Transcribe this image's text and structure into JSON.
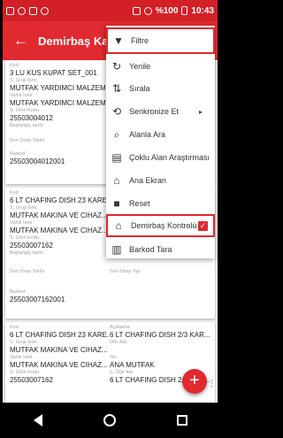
{
  "status_bar": {
    "battery": "%100",
    "time": "10:43",
    "top_right_icons": [
      "nfc-icon",
      "external-link-icon"
    ]
  },
  "app_bar": {
    "title": "Demirbaş Kay"
  },
  "cards": [
    {
      "kod_label": "Kod",
      "kod": "3 LU KUS KUPAT SET_001",
      "grup_label": "S. Grup İsmi",
      "grup": "MUTFAK YARDIMCI MALZEM...",
      "varlik_label": "Varlık İsmi",
      "varlik": "MUTFAK YARDIMCI MALZEM...",
      "urun_label": "S. Ürün Kodu",
      "urun_kodu": "25503004012",
      "baslangic_label": "Başlangıç tarihi",
      "son_onay_label": "Son Onay Tarihi",
      "barkod_label": "Barkod",
      "barkod": "25503004012001"
    },
    {
      "kod_label": "Kod",
      "kod": "6 LT CHAFING DISH 23 KARE...",
      "grup_label": "S. Grup İsmi",
      "grup": "MUTFAK MAKINA VE CIHAZ...",
      "varlik_label": "Varlık İsmi",
      "varlik": "MUTFAK MAKINA VE CIHAZ...",
      "urun_label": "S. Ürün Kodu",
      "urun_kodu": "25503007162",
      "baslangic_label": "Başlangıç tarihi",
      "son_onay_label": "Son Onay Tarihi",
      "son_onay_tipi_label": "Son Onay Tipi",
      "barkod_label": "Barkod",
      "barkod": "25503007162001"
    },
    {
      "kod_label": "Kod",
      "kod": "6 LT CHAFING DISH 23 KARE...",
      "aciklama_label": "Açıklama",
      "aciklama": "6 LT CHAFING DISH 2/3 KAR...",
      "grup_label": "S. Grup İsmi",
      "grup": "MUTFAK MAKINA VE CIHAZ...",
      "ofis_label": "Ofis Adı",
      "varlik_label": "Varlık İsmi",
      "varlik": "MUTFAK MAKINA VE CIHAZ...",
      "yer_label": "Yer",
      "yer": "ANA MUTFAK",
      "urun_label": "S. Ürün Kodu",
      "urun_kodu": "25503007162",
      "oge_label": "S. Öğe Adı",
      "oge": "6 LT CHAFING DISH 2/3 KAR..."
    }
  ],
  "menu": {
    "items": [
      {
        "icon": "filter-icon",
        "glyph": "▼",
        "label": "Filtre"
      },
      {
        "icon": "refresh-icon",
        "glyph": "↻",
        "label": "Yenile"
      },
      {
        "icon": "sort-icon",
        "glyph": "⇅",
        "label": "Sırala"
      },
      {
        "icon": "sync-icon",
        "glyph": "⟲",
        "label": "Senkronize Et",
        "submenu_glyph": "▸"
      },
      {
        "icon": "search-icon",
        "glyph": "⌕",
        "label": "Alanla Ara"
      },
      {
        "icon": "multi-search-icon",
        "glyph": "▤",
        "label": "Çoklu Alan Araştırması"
      },
      {
        "icon": "home-icon",
        "glyph": "⌂",
        "label": "Ana Ekran"
      },
      {
        "icon": "reset-icon",
        "glyph": "■",
        "label": "Reset"
      },
      {
        "icon": "inventory-check-icon",
        "glyph": "⌂",
        "label": "Demirbaş Kontrolü",
        "checked": true,
        "check_glyph": "✓"
      },
      {
        "icon": "barcode-icon",
        "glyph": "▥",
        "label": "Barkod Tara"
      }
    ]
  },
  "fab": {
    "glyph": "+",
    "overflow_glyph": "⋮"
  },
  "colors": {
    "primary": "#e02a2f",
    "status": "#d32027",
    "background": "#ececec"
  }
}
